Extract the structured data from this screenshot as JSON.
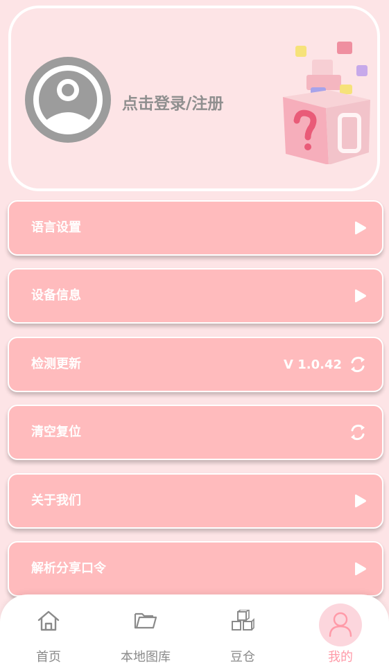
{
  "profile": {
    "login_text": "点击登录/注册",
    "avatar_icon": "user-avatar-icon",
    "decoration_icon": "mystery-box-icon"
  },
  "menu": [
    {
      "label": "语言设置",
      "right_text": "",
      "icon": "play-arrow-icon"
    },
    {
      "label": "设备信息",
      "right_text": "",
      "icon": "play-arrow-icon"
    },
    {
      "label": "检测更新",
      "right_text": "V 1.0.42",
      "icon": "refresh-icon"
    },
    {
      "label": "清空复位",
      "right_text": "",
      "icon": "refresh-icon"
    },
    {
      "label": "关于我们",
      "right_text": "",
      "icon": "play-arrow-icon"
    },
    {
      "label": "解析分享口令",
      "right_text": "",
      "icon": "play-arrow-icon"
    }
  ],
  "nav": [
    {
      "label": "首页",
      "icon": "home-icon",
      "active": false
    },
    {
      "label": "本地图库",
      "icon": "folder-icon",
      "active": false
    },
    {
      "label": "豆仓",
      "icon": "cubes-icon",
      "active": false
    },
    {
      "label": "我的",
      "icon": "user-icon",
      "active": true
    }
  ],
  "colors": {
    "background": "#fde4e6",
    "menu_item": "#ffbbbd",
    "active_nav": "#ff9aa8",
    "inactive_nav": "#8a8a8a"
  }
}
